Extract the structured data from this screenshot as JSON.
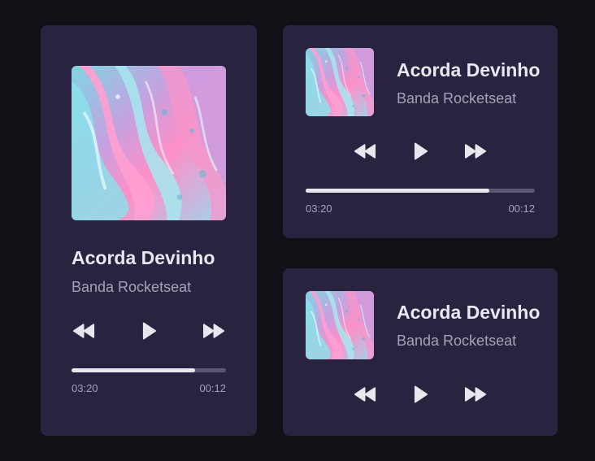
{
  "players": [
    {
      "id": "large",
      "track_title": "Acorda Devinho",
      "artist": "Banda Rocketseat",
      "elapsed": "03:20",
      "remaining": "00:12",
      "progress": 0.8
    },
    {
      "id": "top",
      "track_title": "Acorda Devinho",
      "artist": "Banda Rocketseat",
      "elapsed": "03:20",
      "remaining": "00:12",
      "progress": 0.8
    },
    {
      "id": "bottom",
      "track_title": "Acorda Devinho",
      "artist": "Banda Rocketseat"
    }
  ],
  "icons": {
    "rewind": "rewind-icon",
    "play": "play-icon",
    "forward": "fast-forward-icon"
  },
  "colors": {
    "background": "#121016",
    "card": "#2a2340",
    "title": "#ebe7f2",
    "subtitle": "#a8a0b6",
    "progress_fill": "#e9e6ee",
    "progress_track": "#5d5670"
  }
}
